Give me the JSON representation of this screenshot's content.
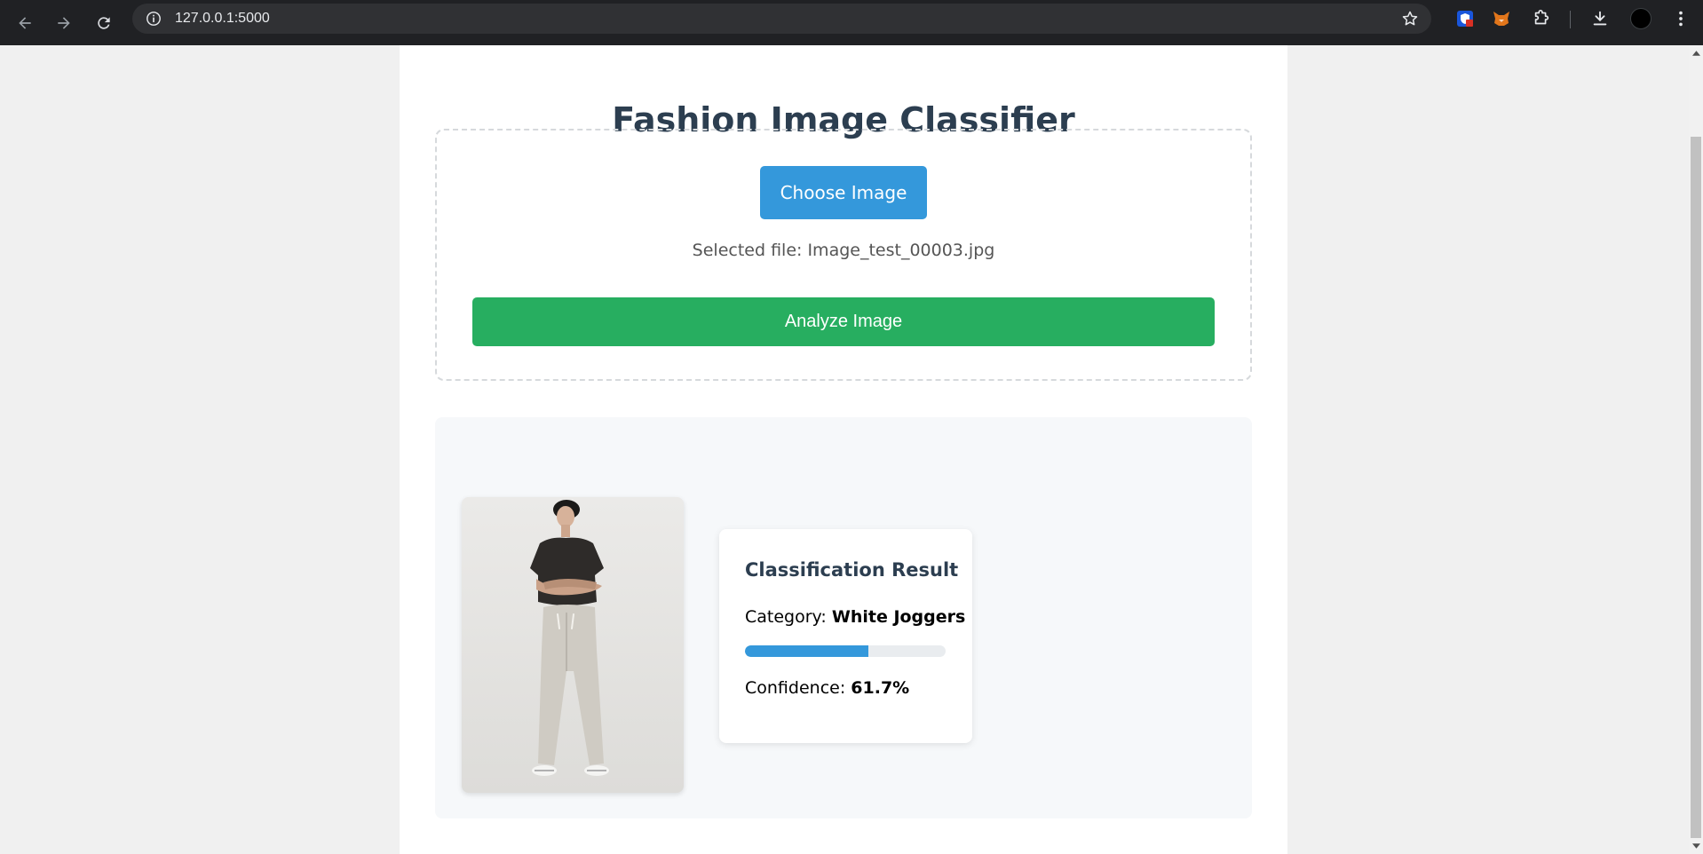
{
  "browser": {
    "url": "127.0.0.1:5000",
    "icons": [
      "back-icon",
      "forward-icon",
      "reload-icon",
      "site-info-icon",
      "bookmark-star-icon",
      "extension-shield-icon",
      "fox-extension-icon",
      "extensions-puzzle-icon",
      "download-icon",
      "profile-avatar",
      "more-menu-icon"
    ]
  },
  "page": {
    "title": "Fashion Image Classifier",
    "choose_label": "Choose Image",
    "selected_file_text": "Selected file: Image_test_00003.jpg",
    "analyze_label": "Analyze Image"
  },
  "result": {
    "card_title": "Classification Result",
    "category_prefix": "Category: ",
    "category_value": "White Joggers",
    "confidence_prefix": "Confidence: ",
    "confidence_value": "61.7%",
    "confidence_fraction": 0.617
  },
  "colors": {
    "primary_blue": "#3498db",
    "success_green": "#27ae60",
    "heading": "#2c3e50"
  }
}
